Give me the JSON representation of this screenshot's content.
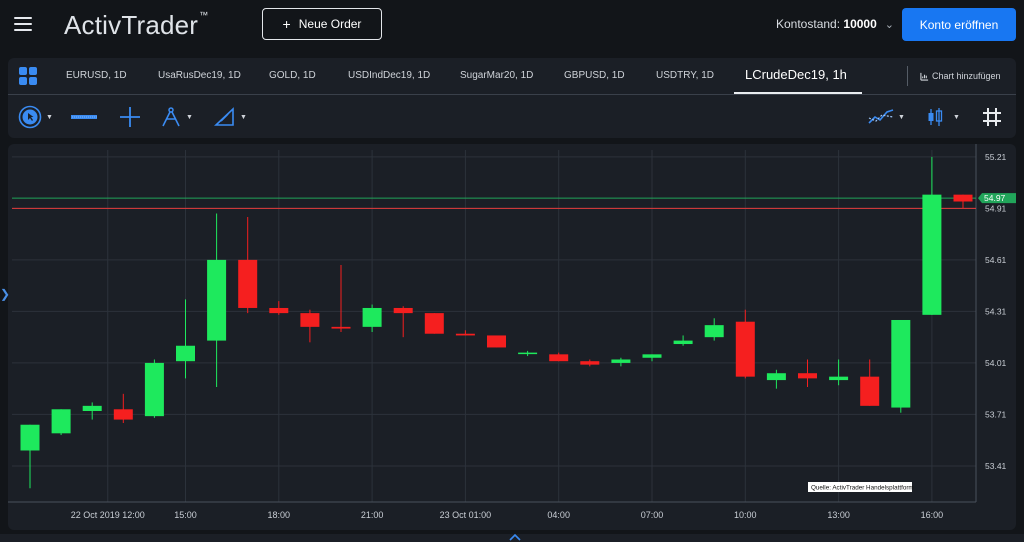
{
  "header": {
    "logo_text": "ActivTrader",
    "logo_tm": "™",
    "new_order_label": "Neue Order",
    "balance_label": "Kontostand:",
    "balance_value": "10000",
    "open_account_label": "Konto eröffnen",
    "accent_color": "#1877f2"
  },
  "tabs": [
    {
      "label": "EURUSD, 1D",
      "active": false
    },
    {
      "label": "UsaRusDec19, 1D",
      "active": false
    },
    {
      "label": "GOLD, 1D",
      "active": false
    },
    {
      "label": "USDIndDec19, 1D",
      "active": false
    },
    {
      "label": "SugarMar20, 1D",
      "active": false
    },
    {
      "label": "GBPUSD, 1D",
      "active": false
    },
    {
      "label": "USDTRY, 1D",
      "active": false
    },
    {
      "label": "LCrudeDec19, 1h",
      "active": true
    }
  ],
  "add_chart_label": "Chart hinzufügen",
  "toolbar_icons": [
    "cursor-mode-icon",
    "indicator-icon",
    "crosshair-icon",
    "drawing-tools-icon",
    "shapes-icon",
    "compare-icon",
    "candle-type-icon",
    "grid-toggle-icon"
  ],
  "chart": {
    "source_note": "Quelle: ActivTrader Handelsplattform",
    "up_color": "#1ee95d",
    "down_color": "#f51f1f",
    "current_price_label": "54.97",
    "hidden_price_label": "54.91"
  },
  "chart_data": {
    "type": "candlestick",
    "symbol": "LCrudeDec19",
    "interval": "1h",
    "ylim": [
      53.2,
      55.25
    ],
    "y_ticks": [
      53.41,
      53.71,
      54.01,
      54.31,
      54.61,
      54.91,
      55.21
    ],
    "x_tick_labels": [
      "22 Oct 2019 12:00",
      "15:00",
      "18:00",
      "21:00",
      "23 Oct 01:00",
      "04:00",
      "07:00",
      "10:00",
      "13:00",
      "16:00"
    ],
    "x_tick_candle_index": [
      2.5,
      5,
      8,
      11,
      14,
      17,
      20,
      23,
      26,
      29
    ],
    "candles": [
      {
        "o": 53.5,
        "h": 53.65,
        "l": 53.28,
        "c": 53.65
      },
      {
        "o": 53.6,
        "h": 53.74,
        "l": 53.59,
        "c": 53.74
      },
      {
        "o": 53.73,
        "h": 53.78,
        "l": 53.68,
        "c": 53.76
      },
      {
        "o": 53.74,
        "h": 53.83,
        "l": 53.66,
        "c": 53.68
      },
      {
        "o": 53.7,
        "h": 54.03,
        "l": 53.69,
        "c": 54.01
      },
      {
        "o": 54.02,
        "h": 54.38,
        "l": 53.92,
        "c": 54.11
      },
      {
        "o": 54.14,
        "h": 54.88,
        "l": 53.87,
        "c": 54.61
      },
      {
        "o": 54.61,
        "h": 54.86,
        "l": 54.3,
        "c": 54.33
      },
      {
        "o": 54.33,
        "h": 54.37,
        "l": 54.29,
        "c": 54.3
      },
      {
        "o": 54.3,
        "h": 54.32,
        "l": 54.13,
        "c": 54.22
      },
      {
        "o": 54.22,
        "h": 54.58,
        "l": 54.19,
        "c": 54.21
      },
      {
        "o": 54.22,
        "h": 54.35,
        "l": 54.19,
        "c": 54.33
      },
      {
        "o": 54.33,
        "h": 54.34,
        "l": 54.16,
        "c": 54.3
      },
      {
        "o": 54.3,
        "h": 54.29,
        "l": 54.18,
        "c": 54.18
      },
      {
        "o": 54.18,
        "h": 54.2,
        "l": 54.17,
        "c": 54.17
      },
      {
        "o": 54.17,
        "h": 54.16,
        "l": 54.1,
        "c": 54.1
      },
      {
        "o": 54.07,
        "h": 54.08,
        "l": 54.05,
        "c": 54.07
      },
      {
        "o": 54.06,
        "h": 54.07,
        "l": 54.02,
        "c": 54.02
      },
      {
        "o": 54.02,
        "h": 54.03,
        "l": 53.99,
        "c": 54.0
      },
      {
        "o": 54.01,
        "h": 54.04,
        "l": 53.99,
        "c": 54.03
      },
      {
        "o": 54.04,
        "h": 54.06,
        "l": 54.02,
        "c": 54.06
      },
      {
        "o": 54.12,
        "h": 54.17,
        "l": 54.11,
        "c": 54.14
      },
      {
        "o": 54.16,
        "h": 54.27,
        "l": 54.14,
        "c": 54.23
      },
      {
        "o": 54.25,
        "h": 54.32,
        "l": 53.92,
        "c": 53.93
      },
      {
        "o": 53.91,
        "h": 53.97,
        "l": 53.86,
        "c": 53.95
      },
      {
        "o": 53.95,
        "h": 54.03,
        "l": 53.87,
        "c": 53.92
      },
      {
        "o": 53.91,
        "h": 54.03,
        "l": 53.88,
        "c": 53.93
      },
      {
        "o": 53.93,
        "h": 54.03,
        "l": 53.76,
        "c": 53.76
      },
      {
        "o": 53.75,
        "h": 54.18,
        "l": 53.72,
        "c": 54.26
      },
      {
        "o": 54.29,
        "h": 55.21,
        "l": 54.29,
        "c": 54.99
      },
      {
        "o": 54.99,
        "h": 54.98,
        "l": 54.91,
        "c": 54.95
      }
    ],
    "price_lines": [
      {
        "value": 54.97,
        "color": "#21a55a"
      },
      {
        "value": 54.91,
        "color": "#e53b3b"
      }
    ],
    "grid": true
  }
}
